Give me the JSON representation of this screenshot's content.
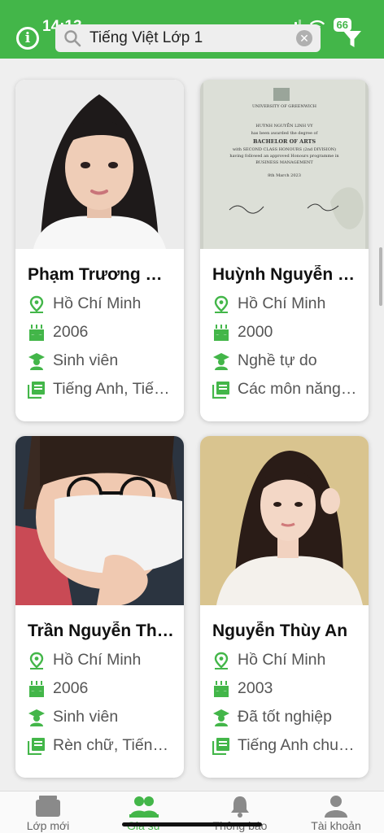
{
  "status_bar": {
    "time": "14:13",
    "battery": "66"
  },
  "search": {
    "query": "Tiếng Việt Lớp 1"
  },
  "tutors": [
    {
      "name": "Phạm Trương Hoàng Ngân",
      "city": "Hồ Chí Minh",
      "birth_year": "2006",
      "occupation": "Sinh viên",
      "subjects": "Tiếng Anh, Tiếng Việt"
    },
    {
      "name": "Huỳnh Nguyễn Linh Vy",
      "city": "Hồ Chí Minh",
      "birth_year": "2000",
      "occupation": "Nghề tự do",
      "subjects": "Các môn năng khiếu"
    },
    {
      "name": "Trần Nguyễn Thảo Vy",
      "city": "Hồ Chí Minh",
      "birth_year": "2006",
      "occupation": "Sinh viên",
      "subjects": "Rèn chữ, Tiếng Việt"
    },
    {
      "name": "Nguyễn Thùy An",
      "city": "Hồ Chí Minh",
      "birth_year": "2003",
      "occupation": "Đã tốt nghiệp",
      "subjects": "Tiếng Anh chuyên"
    }
  ],
  "certificate": {
    "university": "UNIVERSITY OF GREENWICH",
    "holder": "HUỲNH NGUYỄN LINH VY",
    "line1": "has been awarded the degree of",
    "degree": "BACHELOR OF ARTS",
    "line2": "with SECOND CLASS HONOURS (2nd DIVISION)",
    "line3": "having followed an approved Honours programme in",
    "programme": "BUSINESS MANAGEMENT",
    "date": "8th March 2023"
  },
  "tabs": [
    {
      "label": "Lớp mới",
      "icon": "folder-icon"
    },
    {
      "label": "Gia sư",
      "icon": "people-icon"
    },
    {
      "label": "Thông báo",
      "icon": "bell-icon"
    },
    {
      "label": "Tài khoản",
      "icon": "account-icon"
    }
  ],
  "colors": {
    "brand_green": "#43b649",
    "background": "#efefef"
  }
}
